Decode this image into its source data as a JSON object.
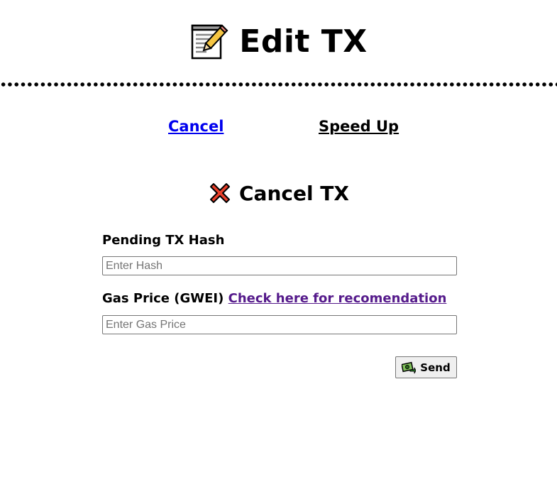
{
  "header": {
    "title": "Edit TX",
    "icon": "notepad-pencil-icon"
  },
  "nav": {
    "cancel_label": "Cancel",
    "speedup_label": "Speed Up",
    "cancel_link_color": "#0000ee"
  },
  "section": {
    "title": "Cancel TX",
    "icon": "red-x-icon"
  },
  "form": {
    "hash_label": "Pending TX Hash",
    "hash_placeholder": "Enter Hash",
    "hash_value": "",
    "gas_label": "Gas Price (GWEI)",
    "gas_link": "Check here for recomendation",
    "gas_link_color": "#551a8b",
    "gas_placeholder": "Enter Gas Price",
    "gas_value": "",
    "send_label": "Send",
    "send_icon": "money-send-icon"
  }
}
